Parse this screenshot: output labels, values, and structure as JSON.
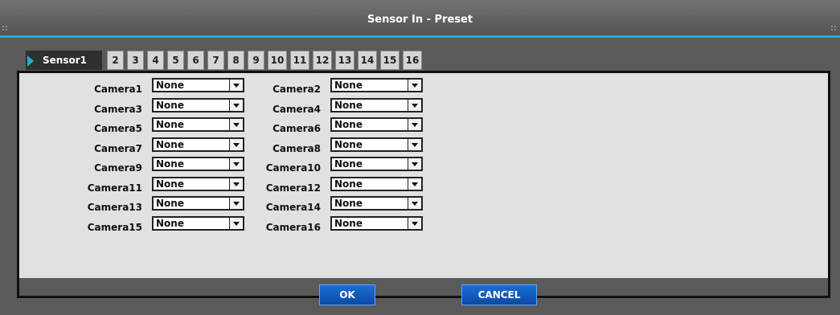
{
  "dialog": {
    "title": "Sensor In - Preset"
  },
  "tabs": [
    {
      "label": "Sensor1",
      "active": true
    },
    {
      "label": "2"
    },
    {
      "label": "3"
    },
    {
      "label": "4"
    },
    {
      "label": "5"
    },
    {
      "label": "6"
    },
    {
      "label": "7"
    },
    {
      "label": "8"
    },
    {
      "label": "9"
    },
    {
      "label": "10"
    },
    {
      "label": "11"
    },
    {
      "label": "12"
    },
    {
      "label": "13"
    },
    {
      "label": "14"
    },
    {
      "label": "15"
    },
    {
      "label": "16"
    }
  ],
  "presets": [
    {
      "camera": "Camera1",
      "value": "None"
    },
    {
      "camera": "Camera2",
      "value": "None"
    },
    {
      "camera": "Camera3",
      "value": "None"
    },
    {
      "camera": "Camera4",
      "value": "None"
    },
    {
      "camera": "Camera5",
      "value": "None"
    },
    {
      "camera": "Camera6",
      "value": "None"
    },
    {
      "camera": "Camera7",
      "value": "None"
    },
    {
      "camera": "Camera8",
      "value": "None"
    },
    {
      "camera": "Camera9",
      "value": "None"
    },
    {
      "camera": "Camera10",
      "value": "None"
    },
    {
      "camera": "Camera11",
      "value": "None"
    },
    {
      "camera": "Camera12",
      "value": "None"
    },
    {
      "camera": "Camera13",
      "value": "None"
    },
    {
      "camera": "Camera14",
      "value": "None"
    },
    {
      "camera": "Camera15",
      "value": "None"
    },
    {
      "camera": "Camera16",
      "value": "None"
    }
  ],
  "buttons": {
    "ok": "OK",
    "cancel": "CANCEL"
  },
  "colors": {
    "accent": "#2fa9cf",
    "button": "#0c49a5",
    "panel": "#e1e1e1",
    "frame": "#5a5a5a"
  }
}
